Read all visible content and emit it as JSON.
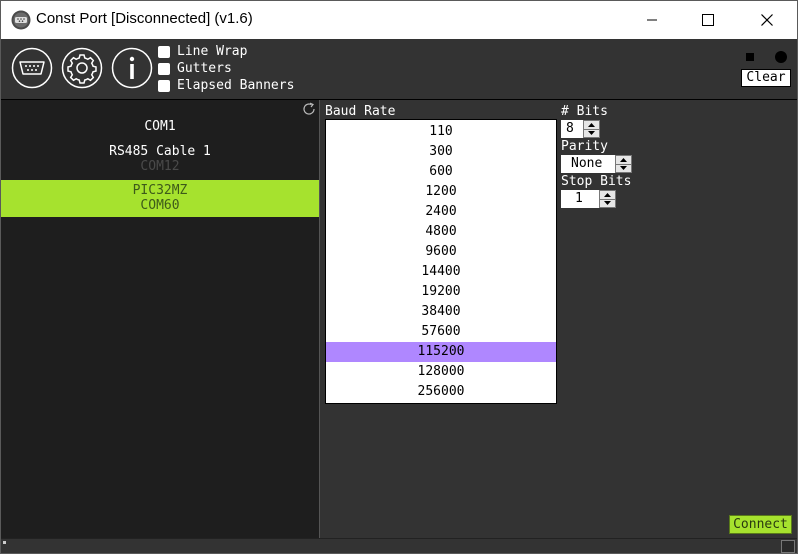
{
  "window": {
    "title": "Const Port [Disconnected] (v1.6)",
    "controls": [
      "minimize",
      "maximize",
      "close"
    ]
  },
  "toolbar": {
    "icons": [
      "serial-port-icon",
      "gear-icon",
      "info-icon"
    ],
    "checkboxes": [
      {
        "label": "Line Wrap",
        "checked": false
      },
      {
        "label": "Gutters",
        "checked": false
      },
      {
        "label": "Elapsed Banners",
        "checked": false
      }
    ],
    "clear_label": "Clear"
  },
  "ports": [
    {
      "name": "COM1",
      "sub": "",
      "selected": false
    },
    {
      "name": "RS485 Cable 1",
      "sub": "COM12",
      "selected": false
    },
    {
      "name": "PIC32MZ",
      "sub": "COM60",
      "selected": true
    }
  ],
  "baud": {
    "label": "Baud Rate",
    "options": [
      "110",
      "300",
      "600",
      "1200",
      "2400",
      "4800",
      "9600",
      "14400",
      "19200",
      "38400",
      "57600",
      "115200",
      "128000",
      "256000"
    ],
    "selected": "115200"
  },
  "settings": {
    "bits_label": "# Bits",
    "bits_value": "8",
    "parity_label": "Parity",
    "parity_value": "None",
    "stop_label": "Stop Bits",
    "stop_value": "1"
  },
  "connect_label": "Connect",
  "colors": {
    "selected_port": "#a6e22e",
    "selected_baud": "#af87ff",
    "connect": "#a6e22e",
    "background": "#333333"
  }
}
